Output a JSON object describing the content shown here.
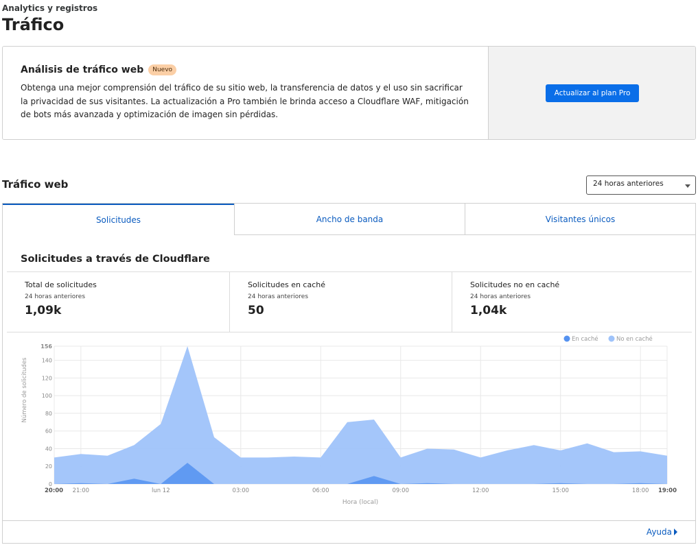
{
  "header": {
    "breadcrumb": "Analytics y registros",
    "title": "Tráfico"
  },
  "promo": {
    "title": "Análisis de tráfico web",
    "badge": "Nuevo",
    "text": "Obtenga una mejor comprensión del tráfico de su sitio web, la transferencia de datos y el uso sin sacrificar la privacidad de sus visitantes. La actualización a Pro también le brinda acceso a Cloudflare WAF, mitigación de bots más avanzada y optimización de imagen sin pérdidas.",
    "button": "Actualizar al plan Pro"
  },
  "traffic": {
    "title": "Tráfico web",
    "range": "24 horas anteriores",
    "tabs": [
      "Solicitudes",
      "Ancho de banda",
      "Visitantes únicos"
    ],
    "chart_title": "Solicitudes a través de Cloudflare",
    "stats": [
      {
        "label": "Total de solicitudes",
        "period": "24 horas anteriores",
        "value": "1,09k"
      },
      {
        "label": "Solicitudes en caché",
        "period": "24 horas anteriores",
        "value": "50"
      },
      {
        "label": "Solicitudes no en caché",
        "period": "24 horas anteriores",
        "value": "1,04k"
      }
    ],
    "help": "Ayuda"
  },
  "colors": {
    "cached": "#5592f0",
    "uncached": "#9fc3fa",
    "accent": "#0a6ee8",
    "link": "#0a5bbf"
  },
  "chart_data": {
    "type": "area",
    "xlabel": "Hora (local)",
    "ylabel": "Número de solicitudes",
    "ylim": [
      0,
      156
    ],
    "y_ticks": [
      0,
      20,
      40,
      60,
      80,
      100,
      120,
      140,
      156
    ],
    "x_tick_labels": [
      "20:00",
      "21:00",
      "lun 12",
      "03:00",
      "06:00",
      "09:00",
      "12:00",
      "15:00",
      "18:00",
      "19:00"
    ],
    "x_tick_hours": [
      0,
      1,
      4,
      7,
      10,
      13,
      16,
      19,
      22,
      23
    ],
    "legend_position": "top-right",
    "x_hours": [
      0,
      1,
      2,
      3,
      4,
      5,
      6,
      7,
      8,
      9,
      10,
      11,
      12,
      13,
      14,
      15,
      16,
      17,
      18,
      19,
      20,
      21,
      22,
      23
    ],
    "series": [
      {
        "name": "En caché",
        "values": [
          0,
          1,
          0,
          6,
          0,
          24,
          0,
          0,
          0,
          0,
          0,
          0,
          9,
          0,
          1,
          0,
          0,
          0,
          0,
          1,
          0,
          0,
          1,
          0
        ]
      },
      {
        "name": "No en caché",
        "values": [
          30,
          34,
          32,
          44,
          68,
          156,
          53,
          30,
          30,
          31,
          30,
          70,
          73,
          30,
          40,
          39,
          30,
          38,
          44,
          38,
          46,
          36,
          37,
          32
        ]
      }
    ]
  }
}
